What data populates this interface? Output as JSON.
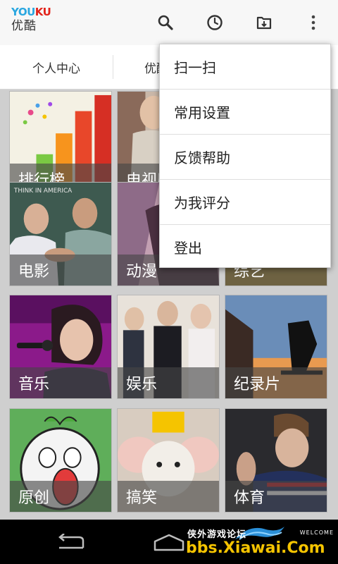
{
  "app": {
    "logo_part1": "YOU",
    "logo_part2": "KU",
    "logo_cn": "优酷",
    "icons": [
      "search-icon",
      "history-icon",
      "download-icon",
      "overflow-menu-icon"
    ]
  },
  "tabs": [
    {
      "label": "个人中心"
    },
    {
      "label": "优酷"
    }
  ],
  "grid": {
    "tiles": [
      {
        "label": "排行榜"
      },
      {
        "label": "电视剧"
      },
      {
        "label": ""
      },
      {
        "label": "电影"
      },
      {
        "label": "动漫"
      },
      {
        "label": "综艺"
      },
      {
        "label": "音乐"
      },
      {
        "label": "娱乐"
      },
      {
        "label": "纪录片"
      },
      {
        "label": "原创"
      },
      {
        "label": "搞笑"
      },
      {
        "label": "体育"
      }
    ]
  },
  "menu": {
    "items": [
      {
        "label": "扫一扫"
      },
      {
        "label": "常用设置"
      },
      {
        "label": "反馈帮助"
      },
      {
        "label": "为我评分"
      },
      {
        "label": "登出"
      }
    ]
  },
  "navbar": {
    "icons": [
      "back-icon",
      "home-icon"
    ]
  },
  "watermark": {
    "small_text": "侠外游戏论坛",
    "welcome": "WELCOME",
    "site": "bbs.Xiawai.Com"
  },
  "colors": {
    "youku_blue": "#2aa7e0",
    "youku_red": "#e2231a",
    "watermark_yellow": "#f5c400"
  }
}
